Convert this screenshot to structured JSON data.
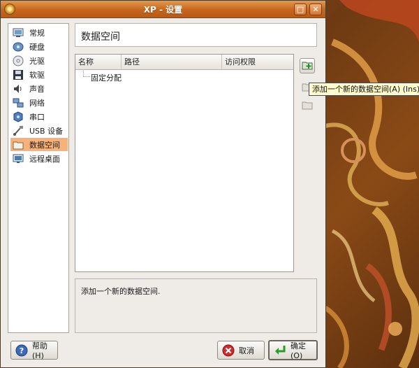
{
  "window": {
    "title": "XP - 设置",
    "maximize_glyph": "□",
    "close_glyph": "✕"
  },
  "sidebar": {
    "items": [
      {
        "label": "常规",
        "icon": "monitor-icon"
      },
      {
        "label": "硬盘",
        "icon": "harddisk-icon"
      },
      {
        "label": "光驱",
        "icon": "cdrom-icon"
      },
      {
        "label": "软驱",
        "icon": "floppy-icon"
      },
      {
        "label": "声音",
        "icon": "speaker-icon"
      },
      {
        "label": "网络",
        "icon": "network-icon"
      },
      {
        "label": "串口",
        "icon": "serial-port-icon"
      },
      {
        "label": "USB 设备",
        "icon": "usb-icon"
      },
      {
        "label": "数据空间",
        "icon": "folder-icon",
        "selected": true
      },
      {
        "label": "远程桌面",
        "icon": "remote-display-icon"
      }
    ]
  },
  "main": {
    "section_title": "数据空间",
    "table": {
      "columns": [
        "名称",
        "路径",
        "访问权限"
      ],
      "rows": [
        {
          "label": "固定分配"
        }
      ]
    },
    "tooltip": "添加一个新的数据空间(A) (Ins)",
    "description": "添加一个新的数据空间."
  },
  "footer": {
    "help_label": "帮助(H)",
    "cancel_label": "取消",
    "ok_label": "确定(O)"
  },
  "colors": {
    "title_bar": "#c7651d",
    "selection": "#f7b27a",
    "tooltip_bg": "#fffbcc"
  }
}
